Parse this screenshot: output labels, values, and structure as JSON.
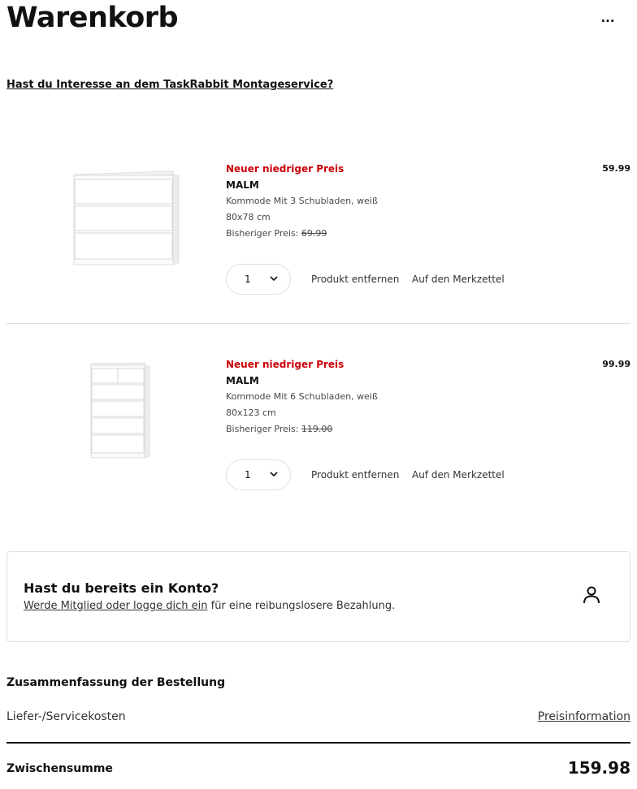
{
  "header": {
    "title": "Warenkorb",
    "more_label": "···"
  },
  "taskrabbit_link": "Hast du Interesse an dem TaskRabbit Montageservice?",
  "products": [
    {
      "badge": "Neuer niedriger Preis",
      "name": "MALM",
      "description": "Kommode Mit 3 Schubladen, weiß",
      "size": "80x78 cm",
      "previous_price_label": "Bisheriger Preis:",
      "previous_price": "69.99",
      "price": "59.99",
      "quantity": "1",
      "remove_label": "Produkt entfernen",
      "wishlist_label": "Auf den Merkzettel",
      "image_icon": "dresser-3-drawers-image"
    },
    {
      "badge": "Neuer niedriger Preis",
      "name": "MALM",
      "description": "Kommode Mit 6 Schubladen, weiß",
      "size": "80x123 cm",
      "previous_price_label": "Bisheriger Preis:",
      "previous_price": "119.00",
      "price": "99.99",
      "quantity": "1",
      "remove_label": "Produkt entfernen",
      "wishlist_label": "Auf den Merkzettel",
      "image_icon": "dresser-6-drawers-image"
    }
  ],
  "account": {
    "title": "Hast du bereits ein Konto?",
    "link_text": "Werde Mitglied oder logge dich ein",
    "rest_text": " für eine reibungslosere Bezahlung.",
    "icon": "user-icon"
  },
  "summary": {
    "title": "Zusammenfassung der Bestellung",
    "delivery_label": "Liefer-/Servicekosten",
    "price_info_link": "Preisinformation",
    "subtotal_label": "Zwischensumme",
    "subtotal_value": "159.98"
  },
  "colors": {
    "badge_red": "#cc0008",
    "text_dark": "#111111",
    "border_gray": "#dfdfdf"
  }
}
